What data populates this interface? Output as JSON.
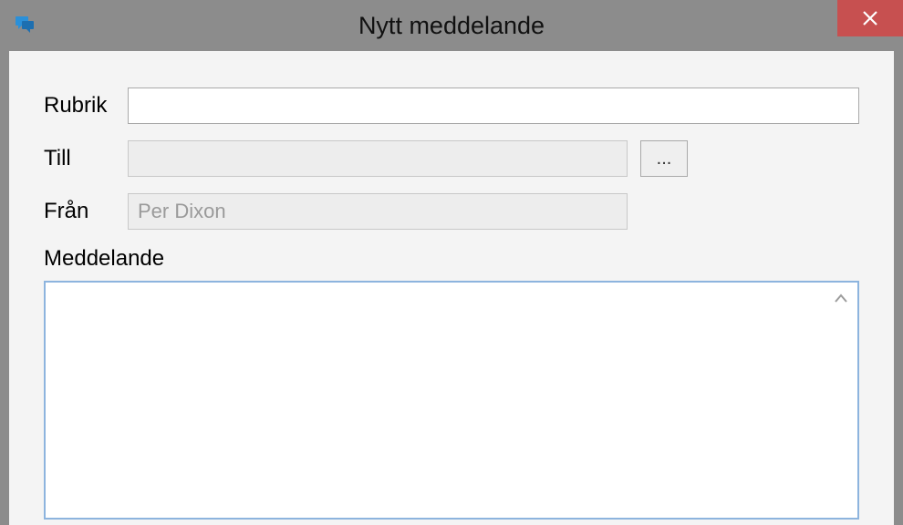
{
  "window": {
    "title": "Nytt meddelande"
  },
  "form": {
    "subject_label": "Rubrik",
    "subject_value": "",
    "to_label": "Till",
    "to_value": "",
    "browse_label": "...",
    "from_label": "Från",
    "from_value": "Per Dixon",
    "message_label": "Meddelande",
    "message_value": ""
  }
}
